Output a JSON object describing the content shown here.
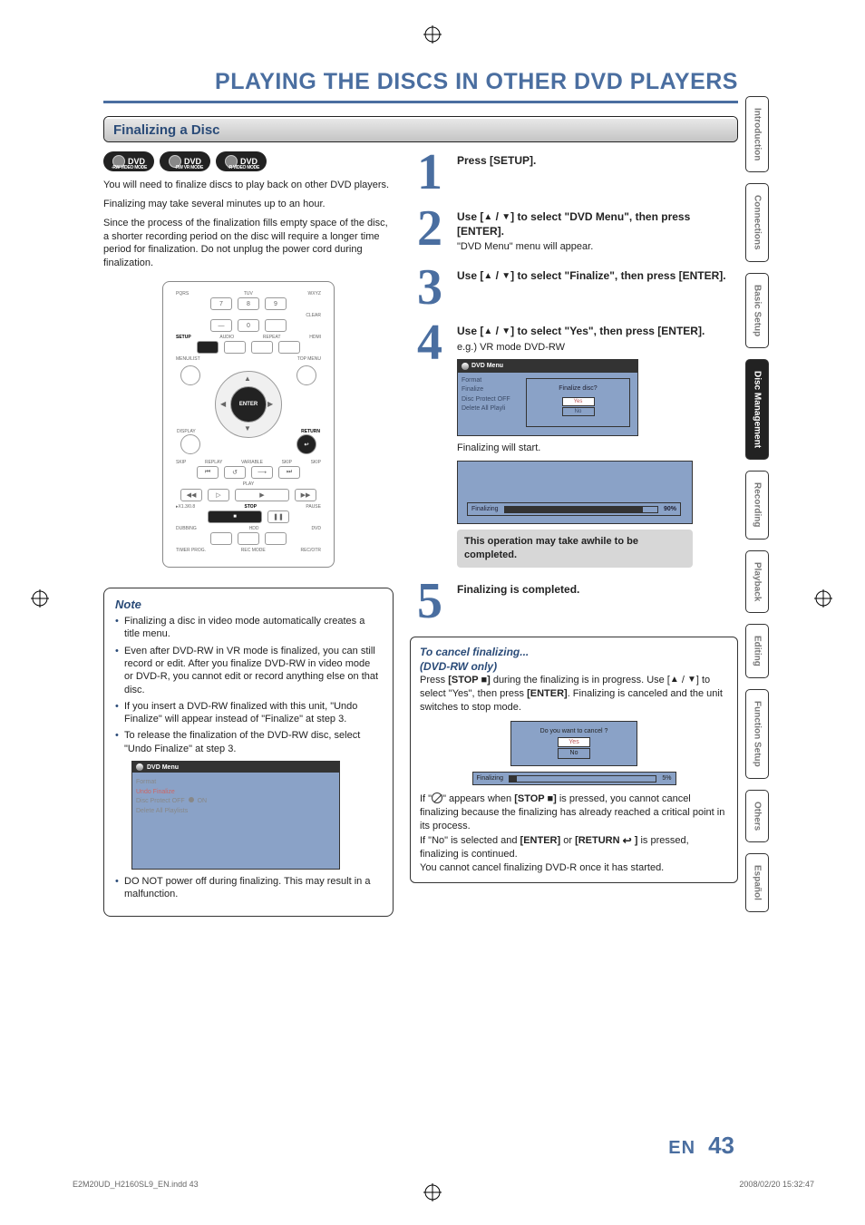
{
  "title": "PLAYING THE DISCS IN OTHER DVD PLAYERS",
  "section": "Finalizing a Disc",
  "badges": [
    {
      "main": "DVD",
      "sub": "-RW VIDEO MODE"
    },
    {
      "main": "DVD",
      "sub": "-RW VR MODE"
    },
    {
      "main": "DVD",
      "sub": "-R VIDEO MODE"
    }
  ],
  "intro1": "You will need to finalize discs to play back on other DVD players.",
  "intro2": "Finalizing may take several minutes up to an hour.",
  "intro3": "Since the process of the finalization fills empty space of the disc, a shorter recording period on the disc will require a longer time period for finalization. Do not unplug the power cord during finalization.",
  "remote": {
    "pqrs": "PQRS",
    "tuv": "TUV",
    "wxyz": "WXYZ",
    "k7": "7",
    "k8": "8",
    "k9": "9",
    "clear": "CLEAR",
    "k0": "0",
    "setup": "SETUP",
    "audio": "AUDIO",
    "repeat": "REPEAT",
    "hdmi": "HDMI",
    "menulist": "MENU/LIST",
    "topmenu": "TOP MENU",
    "enter": "ENTER",
    "display": "DISPLAY",
    "return": "RETURN",
    "skip": "SKIP",
    "replay": "REPLAY",
    "variable": "VARIABLE",
    "play": "PLAY",
    "stop": "STOP",
    "pause": "PAUSE",
    "x13": "▸X1.3/0.8",
    "dubbing": "DUBBING",
    "hdd": "HDD",
    "dvd": "DVD",
    "timer": "TIMER PROG.",
    "recmode": "REC MODE",
    "recotr": "REC/OTR"
  },
  "note": {
    "title": "Note",
    "items": [
      "Finalizing a disc in video mode automatically creates a title menu.",
      "Even after DVD-RW in VR mode is finalized, you can still record or edit. After you finalize DVD-RW in video mode or DVD-R, you cannot edit or record anything else on that disc.",
      "If you insert a DVD-RW finalized with this unit, \"Undo Finalize\" will appear instead of \"Finalize\" at step 3.",
      "To release the finalization of the DVD-RW disc, select \"Undo Finalize\" at step 3."
    ],
    "menu": {
      "title": "DVD Menu",
      "rows": {
        "format": "Format",
        "undo": "Undo Finalize",
        "protect": "Disc Protect OFF",
        "protect_on": "ON",
        "delete": "Delete All Playlists"
      }
    },
    "final_warn": "DO NOT power off during finalizing. This may result in a malfunction."
  },
  "steps": {
    "s1": {
      "num": "1",
      "text": "Press [SETUP]."
    },
    "s2": {
      "num": "2",
      "line1a": "Use [",
      "tri_up": "▲",
      "sep": " / ",
      "tri_dn": "▼",
      "line1b": "] to select \"DVD Menu\", then press [ENTER].",
      "line2": "\"DVD Menu\" menu will appear."
    },
    "s3": {
      "num": "3",
      "linea": "Use [",
      "lineb": "] to select \"Finalize\", then press [ENTER]."
    },
    "s4": {
      "num": "4",
      "linea": "Use [",
      "lineb": "] to select \"Yes\", then press [ENTER].",
      "eg": "e.g.) VR mode DVD-RW",
      "menu": {
        "title": "DVD Menu",
        "rows": [
          "Format",
          "Finalize",
          "Disc Protect OFF",
          "Delete All Playli"
        ],
        "popup_q": "Finalize disc?",
        "yes": "Yes",
        "no": "No"
      },
      "start": "Finalizing will start.",
      "progress_label": "Finalizing",
      "progress_pct": "90%",
      "warn": "This operation may take awhile to be completed."
    },
    "s5": {
      "num": "5",
      "text": "Finalizing is completed."
    }
  },
  "cancel": {
    "title1": "To cancel finalizing...",
    "title2": "(DVD-RW only)",
    "p1a": "Press ",
    "stop": "[STOP ■]",
    "p1b": " during the finalizing is in progress. Use [",
    "p1c": "] to select \"Yes\", then press ",
    "enter": "[ENTER]",
    "p1d": ". Finalizing is canceled and the unit switches to stop mode.",
    "popup_q": "Do you want to cancel ?",
    "yes": "Yes",
    "no": "No",
    "progress_label": "Finalizing",
    "progress_pct": "5%",
    "p2a": "If \"",
    "p2b": "\" appears when ",
    "p2c": " is pressed, you cannot cancel finalizing because the finalizing has already reached a critical point in its process.",
    "p3a": "If \"No\" is selected and ",
    "p3b": " or ",
    "return": "[RETURN ",
    "p3c": " ]",
    "p3d": " is pressed, finalizing is continued.",
    "p4": "You cannot cancel finalizing DVD-R once it has started."
  },
  "page_num": {
    "en": "EN",
    "num": "43"
  },
  "tabs": [
    {
      "label": "Introduction",
      "active": false
    },
    {
      "label": "Connections",
      "active": false
    },
    {
      "label": "Basic Setup",
      "active": false
    },
    {
      "label": "Disc\nManagement",
      "active": true
    },
    {
      "label": "Recording",
      "active": false
    },
    {
      "label": "Playback",
      "active": false
    },
    {
      "label": "Editing",
      "active": false
    },
    {
      "label": "Function Setup",
      "active": false
    },
    {
      "label": "Others",
      "active": false
    },
    {
      "label": "Español",
      "active": false
    }
  ],
  "footer": {
    "left": "E2M20UD_H2160SL9_EN.indd   43",
    "right": "2008/02/20   15:32:47"
  }
}
